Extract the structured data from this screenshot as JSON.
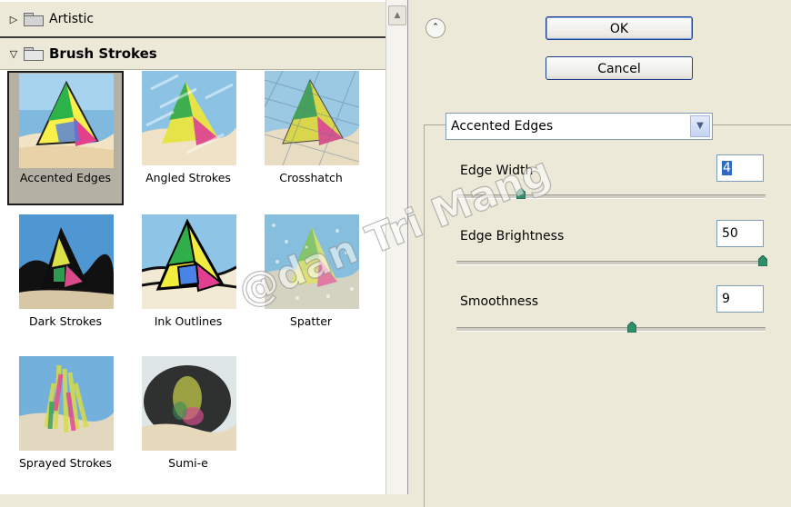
{
  "gallery": {
    "categories": [
      {
        "label": "Artistic",
        "state": "collapsed"
      },
      {
        "label": "Brush Strokes",
        "state": "expanded"
      }
    ],
    "thumbnails": [
      {
        "label": "Accented Edges",
        "selected": true
      },
      {
        "label": "Angled Strokes"
      },
      {
        "label": "Crosshatch"
      },
      {
        "label": "Dark Strokes"
      },
      {
        "label": "Ink Outlines"
      },
      {
        "label": "Spatter"
      },
      {
        "label": "Sprayed Strokes"
      },
      {
        "label": "Sumi-e"
      }
    ]
  },
  "buttons": {
    "ok": "OK",
    "cancel": "Cancel"
  },
  "filter_select": {
    "value": "Accented Edges"
  },
  "params": [
    {
      "label": "Edge Width",
      "value": "4",
      "slider_fraction": 0.21
    },
    {
      "label": "Edge Brightness",
      "value": "50",
      "slider_fraction": 1.0
    },
    {
      "label": "Smoothness",
      "value": "9",
      "slider_fraction": 0.57
    }
  ],
  "watermark": "@dan Tri Mang",
  "colors": {
    "panel_bg": "#ece9d8",
    "button_border": "#1e3f8a",
    "input_border": "#7f9db9",
    "selection": "#316ac5",
    "knob": "#2f8f6a"
  }
}
